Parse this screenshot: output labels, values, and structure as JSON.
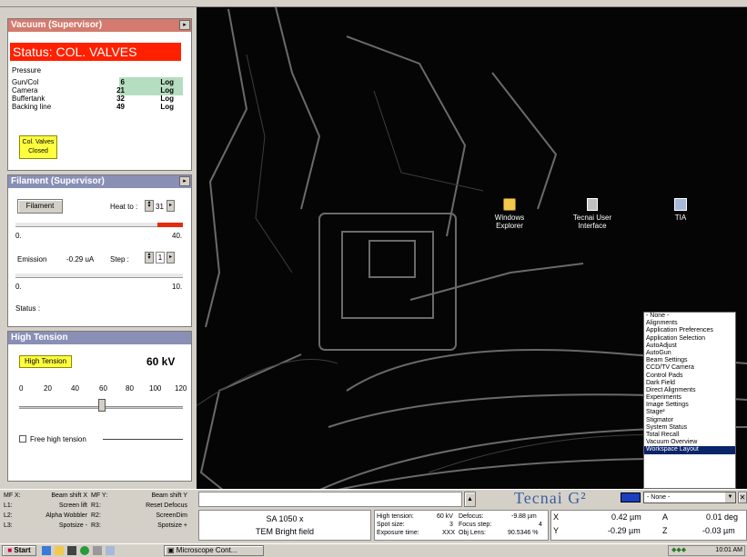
{
  "vacuum": {
    "title": "Vacuum (Supervisor)",
    "status": "Status: COL. VALVES",
    "pressure_label": "Pressure",
    "rows": [
      {
        "name": "Gun/Col",
        "value": "6",
        "unit": "Log"
      },
      {
        "name": "Camera",
        "value": "21",
        "unit": "Log"
      },
      {
        "name": "Buffertank",
        "value": "32",
        "unit": "Log"
      },
      {
        "name": "Backing line",
        "value": "49",
        "unit": "Log"
      }
    ],
    "col_valves_button": "Col. Valves Closed"
  },
  "filament": {
    "title": "Filament (Supervisor)",
    "filament_button": "Filament",
    "heat_to_label": "Heat to :",
    "heat_to_value": "31",
    "scale_min": "0.",
    "scale_max": "40.",
    "heat_level": 0.85,
    "emission_label": "Emission",
    "emission_value": "-0.29 uA",
    "step_label": "Step :",
    "step_value": "1",
    "scale2_min": "0.",
    "scale2_max": "10.",
    "status_label": "Status :"
  },
  "ht": {
    "title": "High Tension",
    "button": "High Tension",
    "value": "60 kV",
    "scale": [
      "0",
      "20",
      "40",
      "60",
      "80",
      "100",
      "120"
    ],
    "slider_value": 60,
    "free_ht_label": "Free high tension"
  },
  "desktop_icons": [
    {
      "name": "windows-explorer-icon",
      "label": "Windows Explorer"
    },
    {
      "name": "tecnai-user-interface-icon",
      "label": "Tecnai User Interface"
    },
    {
      "name": "tia-icon",
      "label": "TIA"
    }
  ],
  "workspace": {
    "options": [
      "- None -",
      "Alignments",
      "Application Preferences",
      "Application Selection",
      "AutoAdjust",
      "AutoGun",
      "Beam Settings",
      "CCD/TV Camera",
      "Control Pads",
      "Dark Field",
      "Direct Alignments",
      "Experiments",
      "Image Settings",
      "Stage²",
      "Stigmator",
      "System Status",
      "Total Recall",
      "Vacuum Overview",
      "Workspace Layout"
    ],
    "selected_index": 18,
    "current": "- None -"
  },
  "mf": [
    {
      "l": "MF X:",
      "a": "Beam shift X",
      "r": "MF Y:",
      "b": "Beam shift Y"
    },
    {
      "l": "L1:",
      "a": "Screen lift",
      "r": "R1:",
      "b": "Reset Defocus"
    },
    {
      "l": "L2:",
      "a": "Alpha Wobbler",
      "r": "R2:",
      "b": "ScreenDim"
    },
    {
      "l": "L3:",
      "a": "Spotsize -",
      "r": "R3:",
      "b": "Spotsize +"
    }
  ],
  "brand": "Tecnai G²",
  "info": {
    "mag": "SA 1050 x",
    "mode": "TEM Bright field",
    "ht_label": "High tension:",
    "ht_value": "60 kV",
    "spot_label": "Spot size:",
    "spot_value": "3",
    "exp_label": "Exposure time:",
    "exp_value": "XXX",
    "defocus_label": "Defocus:",
    "defocus_value": "-9.88 µm",
    "fstep_label": "Focus step:",
    "fstep_value": "4",
    "obj_label": "Obj Lens:",
    "obj_value": "90.5346 %",
    "x_label": "X",
    "x_value": "0.42 µm",
    "y_label": "Y",
    "y_value": "-0.29 µm",
    "a_label": "A",
    "a_value": "0.01 deg",
    "z_label": "Z",
    "z_value": "-0.03 µm"
  },
  "taskbar": {
    "start": "Start",
    "window": "Microscope Cont...",
    "clock": "10:01 AM"
  }
}
